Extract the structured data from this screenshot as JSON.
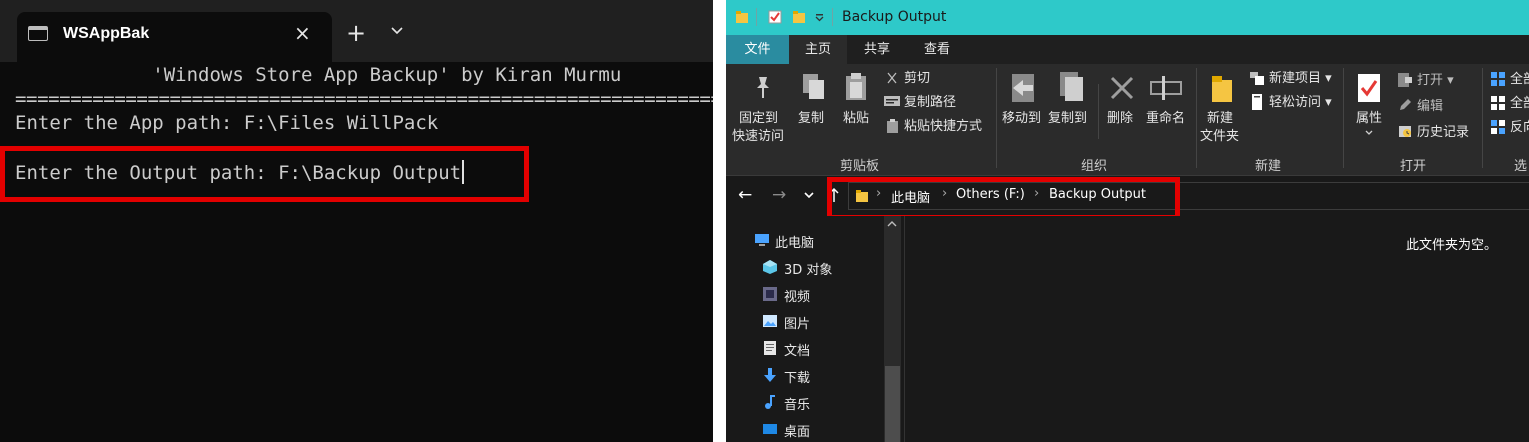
{
  "terminal": {
    "tab_title": "WSAppBak",
    "close_icon": "×",
    "new_tab_icon": "+",
    "lines": [
      "            'Windows Store App Backup' by Kiran Murmu",
      "===========================================================================",
      "Enter the App path: F:\\Files WillPack",
      "Enter the Output path: F:\\Backup Output"
    ],
    "highlight_color": "#e30000"
  },
  "explorer": {
    "title": "Backup Output",
    "ribbon_tabs": [
      "文件",
      "主页",
      "共享",
      "查看"
    ],
    "active_tab": "主页",
    "clipboard": {
      "pin_label": [
        "固定到",
        "快速访问"
      ],
      "copy_label": "复制",
      "paste_label": "粘贴",
      "cut_label": "剪切",
      "copy_path_label": "复制路径",
      "paste_shortcut_label": "粘贴快捷方式",
      "group_label": "剪贴板"
    },
    "organize": {
      "move_to_label": "移动到",
      "copy_to_label": "复制到",
      "delete_label": "删除",
      "rename_label": "重命名",
      "group_label": "组织"
    },
    "new": {
      "new_folder_label": [
        "新建",
        "文件夹"
      ],
      "new_item_label": "新建项目",
      "easy_access_label": "轻松访问",
      "group_label": "新建"
    },
    "open": {
      "properties_label": "属性",
      "open_label": "打开",
      "edit_label": "编辑",
      "history_label": "历史记录",
      "group_label": "打开"
    },
    "select": {
      "select_all_label": "全部",
      "select_none_label": "全部",
      "invert_label": "反向",
      "group_label": "选"
    },
    "address": {
      "crumbs": [
        "此电脑",
        "Others (F:)",
        "Backup Output"
      ]
    },
    "nav_items": [
      {
        "label": "此电脑",
        "icon": "pc-icon"
      },
      {
        "label": "3D 对象",
        "icon": "3d-objects-icon"
      },
      {
        "label": "视频",
        "icon": "videos-icon"
      },
      {
        "label": "图片",
        "icon": "pictures-icon"
      },
      {
        "label": "文档",
        "icon": "documents-icon"
      },
      {
        "label": "下载",
        "icon": "downloads-icon"
      },
      {
        "label": "音乐",
        "icon": "music-icon"
      },
      {
        "label": "桌面",
        "icon": "desktop-icon"
      }
    ],
    "empty_message": "此文件夹为空。",
    "colors": {
      "titlebar": "#2ec9c9",
      "file_tab": "#2a8ca0",
      "folder": "#f5c542"
    }
  }
}
